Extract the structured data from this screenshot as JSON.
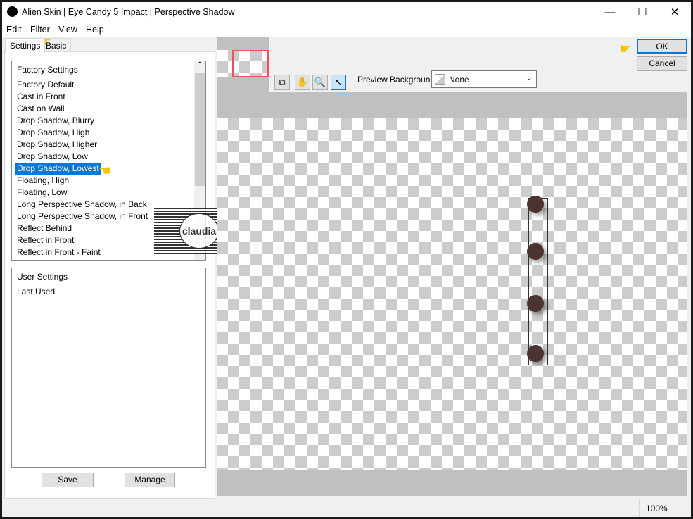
{
  "window": {
    "title": "Alien Skin | Eye Candy 5 Impact | Perspective Shadow",
    "minimize": "—",
    "maximize": "☐",
    "close": "✕"
  },
  "menu": [
    "Edit",
    "Filter",
    "View",
    "Help"
  ],
  "tabs": [
    "Settings",
    "Basic"
  ],
  "factory": {
    "header": "Factory Settings",
    "items": [
      "Factory Default",
      "Cast in Front",
      "Cast on Wall",
      "Drop Shadow, Blurry",
      "Drop Shadow, High",
      "Drop Shadow, Higher",
      "Drop Shadow, Low",
      "Drop Shadow, Lowest",
      "Floating, High",
      "Floating, Low",
      "Long Perspective Shadow, in Back",
      "Long Perspective Shadow, in Front",
      "Reflect Behind",
      "Reflect in Front",
      "Reflect in Front - Faint"
    ],
    "selected": "Drop Shadow, Lowest"
  },
  "user": {
    "header": "User Settings",
    "items": [
      "Last Used"
    ]
  },
  "buttons": {
    "save": "Save",
    "manage": "Manage",
    "ok": "OK",
    "cancel": "Cancel"
  },
  "preview_bg": {
    "label": "Preview Background:",
    "value": "None"
  },
  "tools": [
    "preview-toggle-icon",
    "hand-icon",
    "zoom-icon",
    "pointer-icon"
  ],
  "watermark": "claudia",
  "status": {
    "zoom": "100%"
  },
  "colors": {
    "selection": "#0078d7",
    "shape": "#4a3330",
    "nav_frame": "#f05050"
  }
}
